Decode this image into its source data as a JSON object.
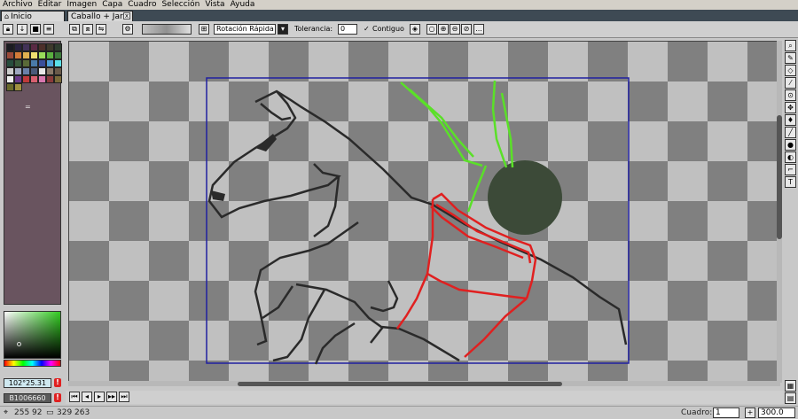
{
  "menu": [
    "Archivo",
    "Editar",
    "Imagen",
    "Capa",
    "Cuadro",
    "Selección",
    "Vista",
    "Ayuda"
  ],
  "tabs": {
    "home": "Inicio",
    "document": "Caballo + Jarro",
    "close_symbol": "x"
  },
  "toolbar": {
    "mode": "Rotación Rápida",
    "tolerance_label": "Tolerancia:",
    "tolerance_value": "0",
    "contiguous_label": "Contiguo",
    "more_label": "..."
  },
  "palette": {
    "swatches": [
      "#1b1b22",
      "#2a2340",
      "#433258",
      "#5a2a44",
      "#4d2f2a",
      "#3e3a2c",
      "#2f3d2f",
      "#9a4a3a",
      "#d27a38",
      "#e0b050",
      "#f0e070",
      "#9adc5a",
      "#5ab040",
      "#3c7a3a",
      "#274d3d",
      "#3a5a3a",
      "#5a6a38",
      "#4a7aa8",
      "#3a4f9a",
      "#4fa0d8",
      "#5ae0e8",
      "#cccccc",
      "#9fa8c0",
      "#6a80a8",
      "#4a5a7a",
      "#e8e8e8",
      "#8a7a6a",
      "#6a5a4a",
      "#eeeeee",
      "#6a3a8a",
      "#c03a3a",
      "#d86070",
      "#d878b0",
      "#8a3a3a",
      "#7a6a3a",
      "#6a6a2a",
      "#a09040"
    ],
    "extra_mark": "="
  },
  "color": {
    "primary_hex": "102°25.31",
    "secondary_hex": "B1006660",
    "alert_symbol": "!"
  },
  "canvas": {
    "paint_color": "#3c4a38",
    "line_color": "#2a2a2a",
    "green_color": "#5ae028",
    "red_color": "#e02020",
    "frame_color": "#2020a0"
  },
  "status": {
    "cursor": "255 92",
    "size": "329 263",
    "frame_label": "Cuadro:",
    "frame_value": "1",
    "zoom": "300.0"
  }
}
